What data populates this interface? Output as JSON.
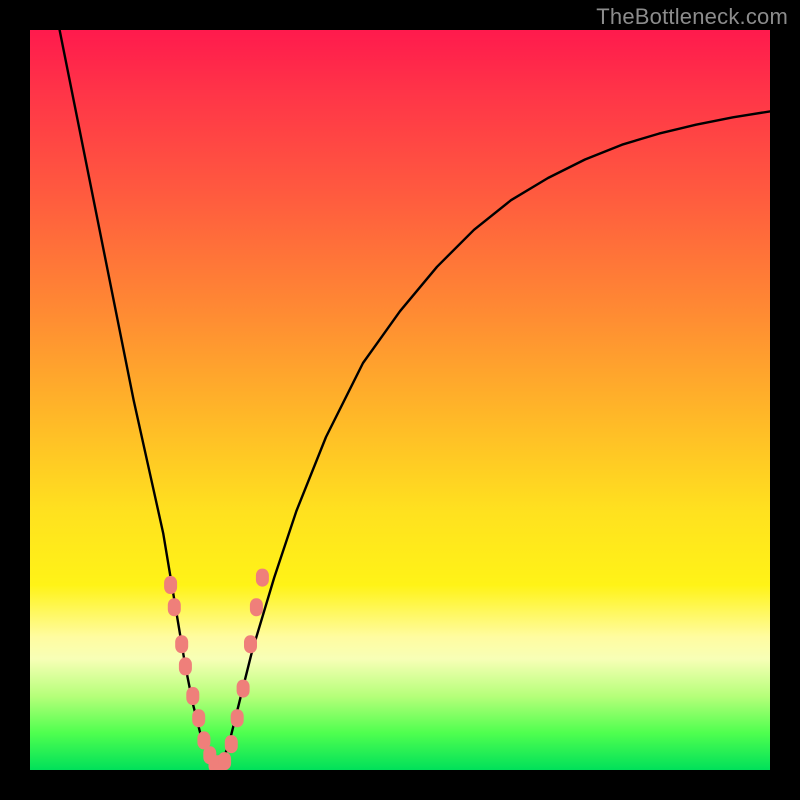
{
  "watermark": "TheBottleneck.com",
  "chart_data": {
    "type": "line",
    "title": "",
    "xlabel": "",
    "ylabel": "",
    "xlim": [
      0,
      100
    ],
    "ylim": [
      0,
      100
    ],
    "grid": false,
    "series": [
      {
        "name": "bottleneck-curve",
        "color": "#000000",
        "x": [
          4,
          6,
          8,
          10,
          12,
          14,
          16,
          18,
          20,
          21,
          22,
          23,
          24,
          25,
          26,
          27,
          28,
          30,
          33,
          36,
          40,
          45,
          50,
          55,
          60,
          65,
          70,
          75,
          80,
          85,
          90,
          95,
          100
        ],
        "y": [
          100,
          90,
          80,
          70,
          60,
          50,
          41,
          32,
          20,
          14,
          9,
          5,
          2,
          0,
          1,
          4,
          8,
          16,
          26,
          35,
          45,
          55,
          62,
          68,
          73,
          77,
          80,
          82.5,
          84.5,
          86,
          87.2,
          88.2,
          89
        ]
      }
    ],
    "markers": [
      {
        "name": "pink-dots",
        "color": "#ef7f7a",
        "shape": "rounded-rect",
        "points": [
          {
            "x": 19.0,
            "y": 25
          },
          {
            "x": 19.5,
            "y": 22
          },
          {
            "x": 20.5,
            "y": 17
          },
          {
            "x": 21.0,
            "y": 14
          },
          {
            "x": 22.0,
            "y": 10
          },
          {
            "x": 22.8,
            "y": 7
          },
          {
            "x": 23.5,
            "y": 4
          },
          {
            "x": 24.3,
            "y": 2
          },
          {
            "x": 25.0,
            "y": 0.8
          },
          {
            "x": 25.6,
            "y": 0.8
          },
          {
            "x": 26.3,
            "y": 1.2
          },
          {
            "x": 27.2,
            "y": 3.5
          },
          {
            "x": 28.0,
            "y": 7
          },
          {
            "x": 28.8,
            "y": 11
          },
          {
            "x": 29.8,
            "y": 17
          },
          {
            "x": 30.6,
            "y": 22
          },
          {
            "x": 31.4,
            "y": 26
          }
        ]
      }
    ],
    "background_gradient": {
      "top": "#ff1a4d",
      "mid1": "#ff8a33",
      "mid2": "#fff317",
      "bottom": "#00e05a"
    }
  }
}
